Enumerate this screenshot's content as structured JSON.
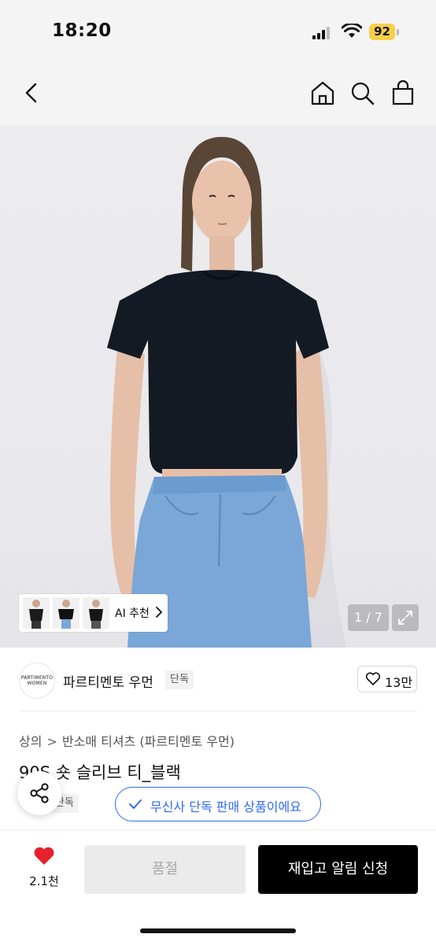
{
  "status_bar": {
    "time": "18:20",
    "battery_level": "92"
  },
  "nav": {
    "back_icon": "chevron-left-icon",
    "home_icon": "home-icon",
    "search_icon": "search-icon",
    "cart_icon": "shopping-bag-icon"
  },
  "gallery": {
    "counter": "1 / 7",
    "ai_label": "AI 추천"
  },
  "brand": {
    "logo_text": "PARTIMENTO WOMEN",
    "name": "파르티멘토 우먼",
    "badge": "단독",
    "likes": "13만"
  },
  "breadcrumb": {
    "category": "상의",
    "subcategory": "반소매 티셔츠 (파르티멘토 우먼)"
  },
  "product": {
    "title": "90S 숏 슬리브 티_블랙",
    "exclusive_tag": "단독"
  },
  "notice": {
    "text": "무신사 단독 판매 상품이에요"
  },
  "actions": {
    "heart_count": "2.1천",
    "soldout_label": "품절",
    "restock_label": "재입고 알림 신청"
  },
  "colors": {
    "accent": "#2f6bf0",
    "heart": "#e8202a",
    "shirt": "#141a24",
    "denim": "#7aa7d8"
  }
}
